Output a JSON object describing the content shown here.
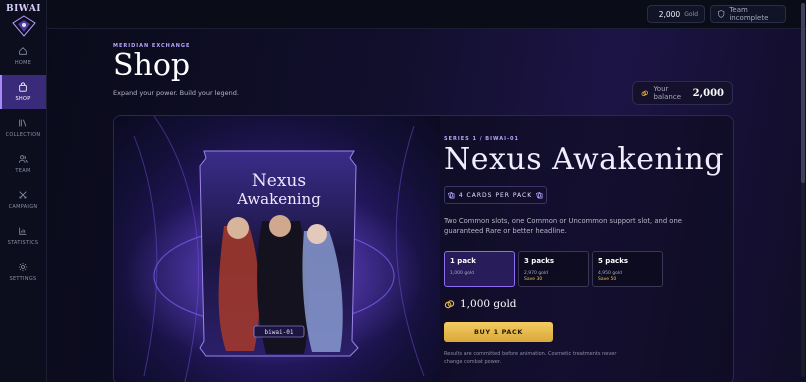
{
  "brand": {
    "logo_text": "BIWAI"
  },
  "sidebar": {
    "items": [
      {
        "label": "HOME",
        "icon": "home-icon"
      },
      {
        "label": "SHOP",
        "icon": "bag-icon",
        "active": true
      },
      {
        "label": "COLLECTION",
        "icon": "library-icon"
      },
      {
        "label": "TEAM",
        "icon": "users-icon"
      },
      {
        "label": "CAMPAIGN",
        "icon": "swords-icon"
      },
      {
        "label": "STATISTICS",
        "icon": "chart-icon"
      },
      {
        "label": "SETTINGS",
        "icon": "gear-icon"
      }
    ]
  },
  "topbar": {
    "gold_value": "2,000",
    "gold_unit": "Gold",
    "team_status": "Team incomplete"
  },
  "header": {
    "eyebrow": "MERIDIAN EXCHANGE",
    "title": "Shop",
    "subtitle": "Expand your power. Build your legend.",
    "balance_label": "Your balance",
    "balance_value": "2,000"
  },
  "pack": {
    "series": "SERIES 1 / BIWAI-01",
    "title": "Nexus Awakening",
    "art_title_line1": "Nexus",
    "art_title_line2": "Awakening",
    "art_code": "biwai-01",
    "cards_per_pack": "4 CARDS PER PACK",
    "description": "Two Common slots, one Common or Uncommon support slot, and one guaranteed Rare or better headline.",
    "options": [
      {
        "name": "1 pack",
        "price": "1,000 gold",
        "save": ""
      },
      {
        "name": "3 packs",
        "price": "2,970 gold",
        "save": "Save 30"
      },
      {
        "name": "5 packs",
        "price": "4,950 gold",
        "save": "Save 50"
      }
    ],
    "selected_option": 0,
    "total": "1,000 gold",
    "buy_label": "BUY 1 PACK",
    "note": "Results are committed before animation. Cosmetic treatments never change combat power."
  },
  "colors": {
    "accent": "#8b6cf2",
    "gold": "#f3cd62",
    "background": "#090b17",
    "active_nav": "#3a2a7a"
  }
}
